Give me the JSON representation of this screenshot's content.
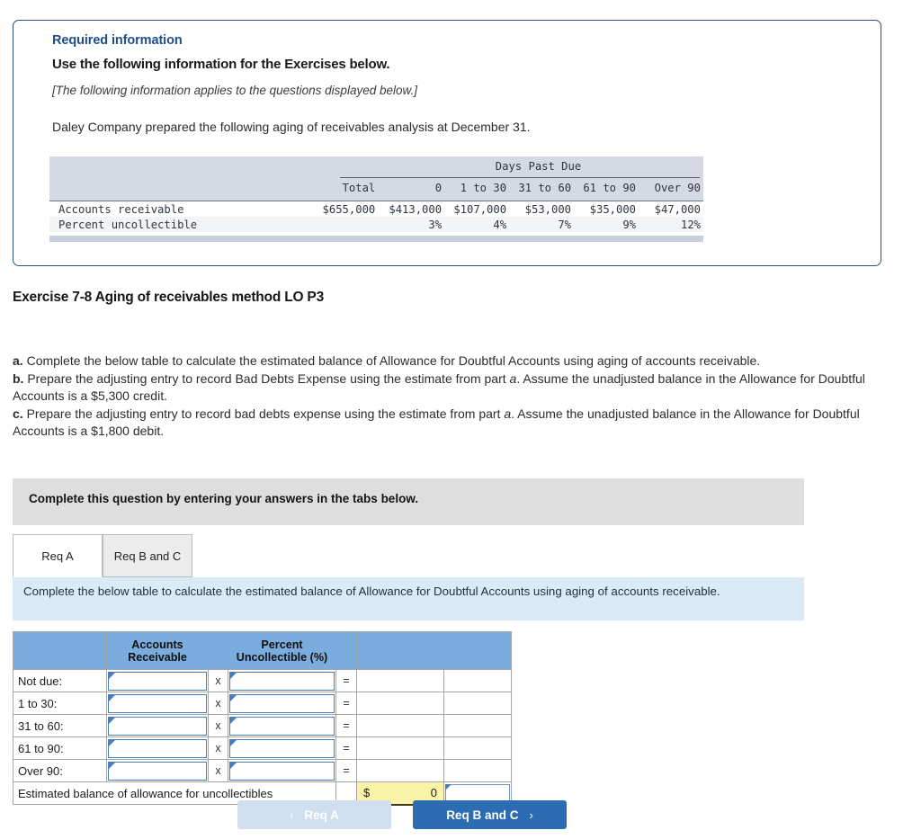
{
  "required_card": {
    "title": "Required information",
    "subtitle": "Use the following information for the Exercises below.",
    "applies_note": "[The following information applies to the questions displayed below.]",
    "intro": "Daley Company prepared the following aging of receivables analysis at December 31."
  },
  "aging_table": {
    "group_header": "Days Past Due",
    "col_total": "Total",
    "col_0": "0",
    "col_1_30": "1 to 30",
    "col_31_60": "31 to 60",
    "col_61_90": "61 to 90",
    "col_over_90": "Over 90",
    "row1_label": "Accounts receivable",
    "row1_total": "$655,000",
    "row1_0": "$413,000",
    "row1_1_30": "$107,000",
    "row1_31_60": "$53,000",
    "row1_61_90": "$35,000",
    "row1_over_90": "$47,000",
    "row2_label": "Percent uncollectible",
    "row2_total": "",
    "row2_0": "3%",
    "row2_1_30": "4%",
    "row2_31_60": "7%",
    "row2_61_90": "9%",
    "row2_over_90": "12%"
  },
  "exercise": {
    "title": "Exercise 7-8 Aging of receivables method LO P3"
  },
  "requirements": {
    "a_marker": "a.",
    "a_text": " Complete the below table to calculate the estimated balance of Allowance for Doubtful Accounts using aging of accounts receivable.",
    "b_marker": "b.",
    "b_text_1": " Prepare the adjusting entry to record Bad Debts Expense using the estimate from part ",
    "b_em": "a",
    "b_text_2": ". Assume the unadjusted balance in the Allowance for Doubtful Accounts is a $5,300 credit.",
    "c_marker": "c.",
    "c_text_1": " Prepare the adjusting entry to record bad debts expense using the estimate from part ",
    "c_em": "a",
    "c_text_2": ". Assume the unadjusted balance in the Allowance for Doubtful Accounts is a $1,800 debit."
  },
  "instruction_band": {
    "text": "Complete this question by entering your answers in the tabs below."
  },
  "tabs": {
    "req_a": "Req A",
    "req_b_and_c": "Req B and C"
  },
  "tab_instruction": {
    "text": "Complete the below table to calculate the estimated balance of Allowance for Doubtful Accounts using aging of accounts receivable."
  },
  "answer_table": {
    "header_blank": "",
    "header_accounts_receivable": "Accounts Receivable",
    "header_mult_blank": "",
    "header_percent_uncollectible": "Percent Uncollectible (%)",
    "header_eq_blank": "",
    "header_result_blank": "",
    "header_extra_blank": "",
    "multiply_symbol": "x",
    "equals_symbol": "=",
    "rows": [
      {
        "label": "Not due:",
        "receivable": "",
        "percent": "",
        "result": ""
      },
      {
        "label": "1 to 30:",
        "receivable": "",
        "percent": "",
        "result": ""
      },
      {
        "label": "31 to 60:",
        "receivable": "",
        "percent": "",
        "result": ""
      },
      {
        "label": "61 to 90:",
        "receivable": "",
        "percent": "",
        "result": ""
      },
      {
        "label": "Over 90:",
        "receivable": "",
        "percent": "",
        "result": ""
      }
    ],
    "total_label": "Estimated balance of allowance for uncollectibles",
    "total_currency": "$",
    "total_value": "0"
  },
  "nav": {
    "prev_label": "Req A",
    "prev_chevron": "‹",
    "next_label": "Req B and C",
    "next_chevron": "›"
  },
  "colors": {
    "card_border": "#2d4f87",
    "heading_blue": "#1f4e8c",
    "table_header_blue": "#7aaddd",
    "instruction_gray": "#dedede",
    "instruction_blue": "#daeaf7",
    "input_border_blue": "#4a7ebb",
    "total_yellow": "#fbf4a8",
    "button_active_blue": "#2b6cb3",
    "button_disabled_blue": "#cfdff0"
  }
}
